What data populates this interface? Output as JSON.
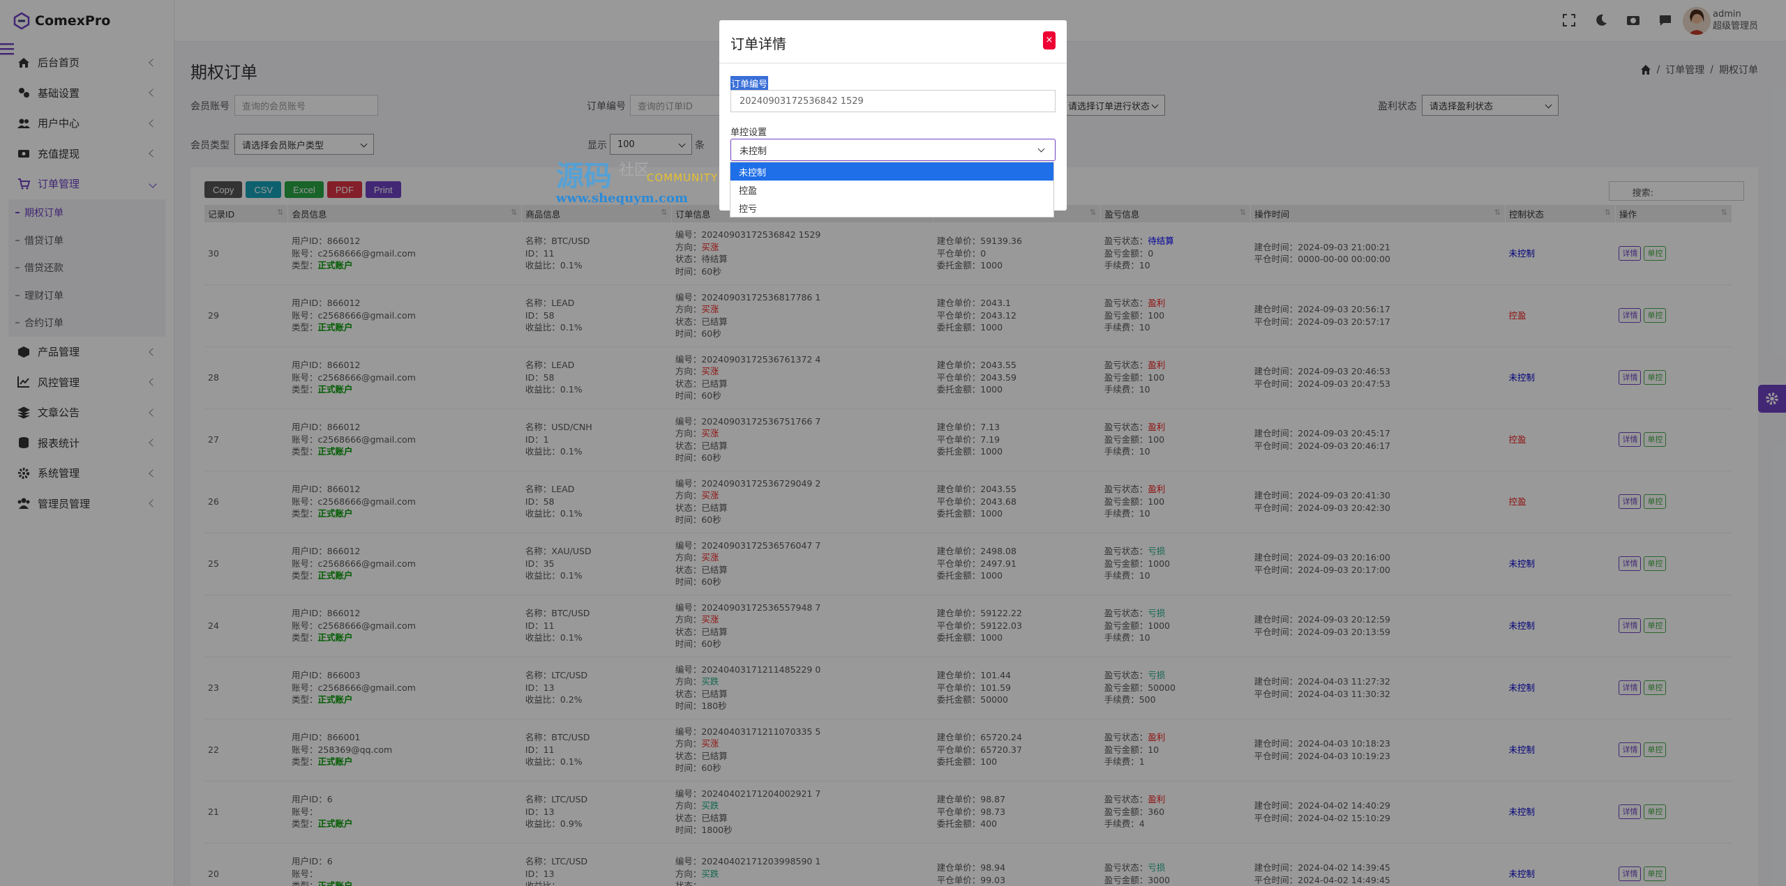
{
  "brand": {
    "name": "ComexPro"
  },
  "sidebar": {
    "items": [
      {
        "label": "后台首页",
        "icon": "home-icon"
      },
      {
        "label": "基础设置",
        "icon": "settings-icon"
      },
      {
        "label": "用户中心",
        "icon": "users-icon"
      },
      {
        "label": "充值提现",
        "icon": "wallet-icon"
      },
      {
        "label": "订单管理",
        "icon": "cart-icon"
      },
      {
        "label": "产品管理",
        "icon": "box-icon"
      },
      {
        "label": "风控管理",
        "icon": "chart-icon"
      },
      {
        "label": "文章公告",
        "icon": "layers-icon"
      },
      {
        "label": "报表统计",
        "icon": "database-icon"
      },
      {
        "label": "系统管理",
        "icon": "gear-icon"
      },
      {
        "label": "管理员管理",
        "icon": "admins-icon"
      }
    ],
    "subitems": [
      "期权订单",
      "借贷订单",
      "借贷还款",
      "理财订单",
      "合约订单"
    ]
  },
  "user": {
    "name": "admin",
    "role": "超级管理员"
  },
  "page": {
    "title": "期权订单",
    "breadcrumb": [
      "订单管理",
      "期权订单"
    ]
  },
  "filters": {
    "member_label": "会员账号",
    "member_placeholder": "查询的会员账号",
    "order_label": "订单编号",
    "order_placeholder": "查询的订单ID",
    "status_value": "请选择订单进行状态",
    "profit_label": "盈利状态",
    "profit_value": "请选择盈利状态",
    "type_label": "会员类型",
    "type_value": "请选择会员账户类型",
    "show_label": "显示",
    "show_value": "100",
    "show_suffix": "条"
  },
  "buttons": {
    "copy": "Copy",
    "csv": "CSV",
    "excel": "Excel",
    "pdf": "PDF",
    "print": "Print"
  },
  "search_label": "搜索:",
  "table": {
    "headers": [
      "记录ID",
      "会员信息",
      "商品信息",
      "订单信息",
      "",
      "盈亏信息",
      "操作时间",
      "控制状态",
      "操作"
    ],
    "rows": [
      {
        "id": "30",
        "uid": "用户ID：866012",
        "acct": "账号：c2568666@gmail.com",
        "type": "正式账户",
        "pname": "名称：BTC/USD",
        "pid": "ID：11",
        "ratio": "收益比：0.1%",
        "ono": "编号：20240903172536842 1529",
        "odir": "买涨",
        "ostat": "状态：待结算",
        "otime": "时间：60秒",
        "p1": "建仓单价：59139.36",
        "p2": "平仓单价：0",
        "p3": "委托金额：1000",
        "pl_state": "待结算",
        "pl_amt": "盈亏金额：0",
        "fee": "手续费：10",
        "t1": "建仓时间：2024-09-03 21:00:21",
        "t2": "平仓时间：0000-00-00 00:00:00",
        "ctl": "未控制"
      },
      {
        "id": "29",
        "uid": "用户ID：866012",
        "acct": "账号：c2568666@gmail.com",
        "type": "正式账户",
        "pname": "名称：LEAD",
        "pid": "ID：58",
        "ratio": "收益比：0.1%",
        "ono": "编号：20240903172536817786 1",
        "odir": "买涨",
        "ostat": "状态：已结算",
        "otime": "时间：60秒",
        "p1": "建仓单价：2043.1",
        "p2": "平仓单价：2043.12",
        "p3": "委托金额：1000",
        "pl_state": "盈利",
        "pl_amt": "盈亏金额：100",
        "fee": "手续费：10",
        "t1": "建仓时间：2024-09-03 20:56:17",
        "t2": "平仓时间：2024-09-03 20:57:17",
        "ctl": "控盈"
      },
      {
        "id": "28",
        "uid": "用户ID：866012",
        "acct": "账号：c2568666@gmail.com",
        "type": "正式账户",
        "pname": "名称：LEAD",
        "pid": "ID：58",
        "ratio": "收益比：0.1%",
        "ono": "编号：20240903172536761372 4",
        "odir": "买涨",
        "ostat": "状态：已结算",
        "otime": "时间：60秒",
        "p1": "建仓单价：2043.55",
        "p2": "平仓单价：2043.59",
        "p3": "委托金额：1000",
        "pl_state": "盈利",
        "pl_amt": "盈亏金额：100",
        "fee": "手续费：10",
        "t1": "建仓时间：2024-09-03 20:46:53",
        "t2": "平仓时间：2024-09-03 20:47:53",
        "ctl": "未控制"
      },
      {
        "id": "27",
        "uid": "用户ID：866012",
        "acct": "账号：c2568666@gmail.com",
        "type": "正式账户",
        "pname": "名称：USD/CNH",
        "pid": "ID：1",
        "ratio": "收益比：0.1%",
        "ono": "编号：20240903172536751766 7",
        "odir": "买涨",
        "ostat": "状态：已结算",
        "otime": "时间：60秒",
        "p1": "建仓单价：7.13",
        "p2": "平仓单价：7.19",
        "p3": "委托金额：1000",
        "pl_state": "盈利",
        "pl_amt": "盈亏金额：100",
        "fee": "手续费：10",
        "t1": "建仓时间：2024-09-03 20:45:17",
        "t2": "平仓时间：2024-09-03 20:46:17",
        "ctl": "控盈"
      },
      {
        "id": "26",
        "uid": "用户ID：866012",
        "acct": "账号：c2568666@gmail.com",
        "type": "正式账户",
        "pname": "名称：LEAD",
        "pid": "ID：58",
        "ratio": "收益比：0.1%",
        "ono": "编号：20240903172536729049 2",
        "odir": "买涨",
        "ostat": "状态：已结算",
        "otime": "时间：60秒",
        "p1": "建仓单价：2043.55",
        "p2": "平仓单价：2043.68",
        "p3": "委托金额：1000",
        "pl_state": "盈利",
        "pl_amt": "盈亏金额：100",
        "fee": "手续费：10",
        "t1": "建仓时间：2024-09-03 20:41:30",
        "t2": "平仓时间：2024-09-03 20:42:30",
        "ctl": "控盈"
      },
      {
        "id": "25",
        "uid": "用户ID：866012",
        "acct": "账号：c2568666@gmail.com",
        "type": "正式账户",
        "pname": "名称：XAU/USD",
        "pid": "ID：35",
        "ratio": "收益比：0.1%",
        "ono": "编号：20240903172536576047 7",
        "odir": "买涨",
        "ostat": "状态：已结算",
        "otime": "时间：60秒",
        "p1": "建仓单价：2498.08",
        "p2": "平仓单价：2497.91",
        "p3": "委托金额：1000",
        "pl_state": "亏损",
        "pl_amt": "盈亏金额：1000",
        "fee": "手续费：10",
        "t1": "建仓时间：2024-09-03 20:16:00",
        "t2": "平仓时间：2024-09-03 20:17:00",
        "ctl": "未控制"
      },
      {
        "id": "24",
        "uid": "用户ID：866012",
        "acct": "账号：c2568666@gmail.com",
        "type": "正式账户",
        "pname": "名称：BTC/USD",
        "pid": "ID：11",
        "ratio": "收益比：0.1%",
        "ono": "编号：20240903172536557948 7",
        "odir": "买涨",
        "ostat": "状态：已结算",
        "otime": "时间：60秒",
        "p1": "建仓单价：59122.22",
        "p2": "平仓单价：59122.03",
        "p3": "委托金额：1000",
        "pl_state": "亏损",
        "pl_amt": "盈亏金额：1000",
        "fee": "手续费：10",
        "t1": "建仓时间：2024-09-03 20:12:59",
        "t2": "平仓时间：2024-09-03 20:13:59",
        "ctl": "未控制"
      },
      {
        "id": "23",
        "uid": "用户ID：866003",
        "acct": "账号：c2568666@gmail.com",
        "type": "正式账户",
        "pname": "名称：LTC/USD",
        "pid": "ID：13",
        "ratio": "收益比：0.2%",
        "ono": "编号：20240403171211485229 0",
        "odir": "买跌",
        "ostat": "状态：已结算",
        "otime": "时间：180秒",
        "p1": "建仓单价：101.44",
        "p2": "平仓单价：101.59",
        "p3": "委托金额：50000",
        "pl_state": "亏损",
        "pl_amt": "盈亏金额：50000",
        "fee": "手续费：500",
        "t1": "建仓时间：2024-04-03 11:27:32",
        "t2": "平仓时间：2024-04-03 11:30:32",
        "ctl": "未控制"
      },
      {
        "id": "22",
        "uid": "用户ID：866001",
        "acct": "账号：258369@qq.com",
        "type": "正式账户",
        "pname": "名称：BTC/USD",
        "pid": "ID：11",
        "ratio": "收益比：0.1%",
        "ono": "编号：20240403171211070335 5",
        "odir": "买涨",
        "ostat": "状态：已结算",
        "otime": "时间：60秒",
        "p1": "建仓单价：65720.24",
        "p2": "平仓单价：65720.37",
        "p3": "委托金额：100",
        "pl_state": "盈利",
        "pl_amt": "盈亏金额：10",
        "fee": "手续费：1",
        "t1": "建仓时间：2024-04-03 10:18:23",
        "t2": "平仓时间：2024-04-03 10:19:23",
        "ctl": "未控制"
      },
      {
        "id": "21",
        "uid": "用户ID：6",
        "acct": "账号：",
        "type": "正式账户",
        "pname": "名称：LTC/USD",
        "pid": "ID：13",
        "ratio": "收益比：0.9%",
        "ono": "编号：20240402171204002921 7",
        "odir": "买跌",
        "ostat": "状态：已结算",
        "otime": "时间：1800秒",
        "p1": "建仓单价：98.87",
        "p2": "平仓单价：98.73",
        "p3": "委托金额：400",
        "pl_state": "盈利",
        "pl_amt": "盈亏金额：360",
        "fee": "手续费：4",
        "t1": "建仓时间：2024-04-02 14:40:29",
        "t2": "平仓时间：2024-04-02 15:10:29",
        "ctl": "未控制"
      },
      {
        "id": "20",
        "uid": "用户ID：6",
        "acct": "账号：",
        "type": "正式账户",
        "pname": "名称：LTC/USD",
        "pid": "ID：13",
        "ratio": "收益比：",
        "ono": "编号：20240402171203998590 1",
        "odir": "买跌",
        "ostat": "状态：",
        "otime": "",
        "p1": "建仓单价：98.94",
        "p2": "平仓单价：99.03",
        "p3": "",
        "pl_state": "亏损",
        "pl_amt": "盈亏金额：3000",
        "fee": "",
        "t1": "建仓时间：2024-04-02 14:39:45",
        "t2": "平仓时间：2024-04-02 14:49:45",
        "ctl": "未控制"
      }
    ],
    "labels": {
      "type_prefix": "类型：",
      "dir_prefix": "方向：",
      "pl_prefix": "盈亏状态：",
      "detail": "详情",
      "control": "单控"
    }
  },
  "modal": {
    "title": "订单详情",
    "close": "×",
    "order_label": "订单编号",
    "order_value": "20240903172536842 1529",
    "control_label": "单控设置",
    "control_value": "未控制",
    "options": [
      "未控制",
      "控盈",
      "控亏"
    ]
  },
  "watermark": {
    "big": "源码",
    "small": "社区",
    "comm": "COMMUNITY",
    "url": "www.shequym.com"
  },
  "colors": {
    "accent": "#6f42c1",
    "copy": "#555555",
    "csv": "#17a2b8",
    "excel": "#28a745",
    "pdf": "#dc3545",
    "print": "#6f42c1"
  }
}
